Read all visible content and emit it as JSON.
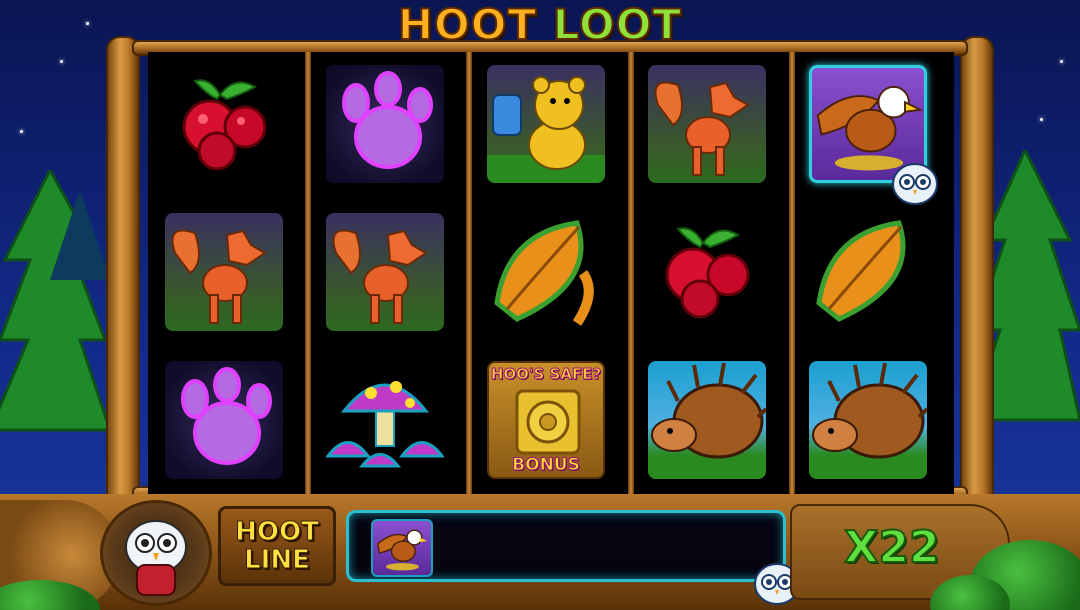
{
  "game": {
    "title_part1": "HOOT",
    "title_part2": "LOOT"
  },
  "reels": [
    [
      "raspberry",
      "fox",
      "paw-print"
    ],
    [
      "paw-print",
      "fox",
      "mushroom"
    ],
    [
      "bear-with-honey",
      "leaf",
      "hoos-safe-bonus"
    ],
    [
      "fox",
      "raspberry",
      "hedgehog"
    ],
    [
      "eagle",
      "leaf",
      "hedgehog"
    ]
  ],
  "bonus_symbol": {
    "top_text": "HOO'S SAFE?",
    "bottom_text": "BONUS"
  },
  "hoot_line": {
    "label_line1": "HOOT",
    "label_line2": "LINE",
    "symbol": "eagle"
  },
  "multiplier": {
    "text": "X22"
  },
  "colors": {
    "accent_cyan": "#30d0e0",
    "title_orange": "#ffb020",
    "title_green": "#8fe03a",
    "multiplier_green": "#60e040",
    "label_yellow": "#ffe040"
  }
}
